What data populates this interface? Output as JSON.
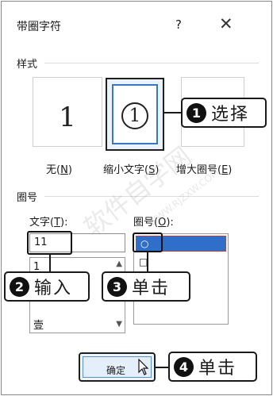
{
  "dialog": {
    "title": "带圈字符",
    "help": "?",
    "close": "✕"
  },
  "style_group": {
    "label": "样式",
    "options": [
      {
        "sample": "1",
        "caption": "无(",
        "key": "N",
        "caption_end": ")",
        "selected": false
      },
      {
        "sample": "1",
        "caption": "缩小文字(",
        "key": "S",
        "caption_end": ")",
        "selected": true
      },
      {
        "sample": "",
        "caption": "增大圈号(",
        "key": "E",
        "caption_end": ")",
        "selected": false
      }
    ]
  },
  "enclosure_group": {
    "label": "圈号",
    "text_label": "文字(",
    "text_key": "T",
    "text_label_end": "):",
    "text_value": "11",
    "text_list": [
      "1",
      "壹"
    ],
    "enclosure_label": "圈号(",
    "enclosure_key": "O",
    "enclosure_label_end": "):",
    "enclosure_list": [
      "○",
      "□"
    ]
  },
  "ok_button": {
    "label": "确定"
  },
  "callouts": [
    {
      "number": "1",
      "text": "选择"
    },
    {
      "number": "2",
      "text": "输入"
    },
    {
      "number": "3",
      "text": "单击"
    },
    {
      "number": "4",
      "text": "单击"
    }
  ],
  "watermark": {
    "text": "软件自学网",
    "url": "WWW.RJZXW.COM"
  },
  "colors": {
    "selection": "#2f6fca",
    "focus_border": "#3b77bd",
    "callout_dark": "#111111"
  }
}
